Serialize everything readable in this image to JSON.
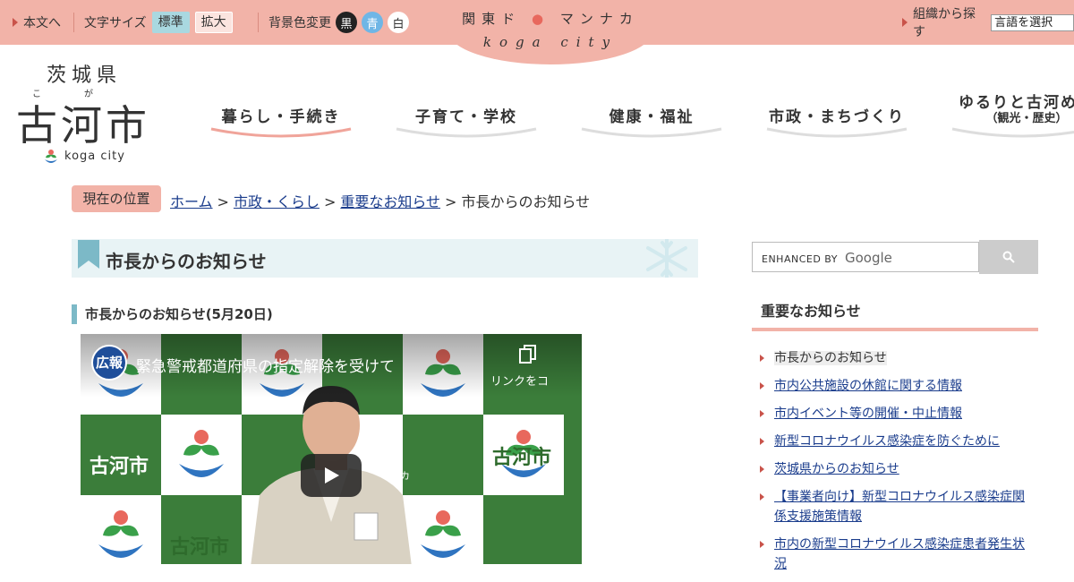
{
  "utility": {
    "skip_label": "本文へ",
    "font_size_label": "文字サイズ",
    "font_size_normal": "標準",
    "font_size_large": "拡大",
    "bg_color_label": "背景色変更",
    "bg_black": "黒",
    "bg_blue": "青",
    "bg_white": "白",
    "org_search_label": "組織から探す",
    "language_select": "言語を選択"
  },
  "center_badge": {
    "top_words": [
      "関東ド",
      "マンナカ"
    ],
    "bottom": "koga city"
  },
  "logo": {
    "prefecture": "茨城県",
    "ruby_1": "こ",
    "ruby_2": "が",
    "city": "古河市",
    "koga_text": "koga city"
  },
  "global_nav": [
    {
      "label": "暮らし・手続き",
      "sub": "",
      "active": true
    },
    {
      "label": "子育て・学校",
      "sub": ""
    },
    {
      "label": "健康・福祉",
      "sub": ""
    },
    {
      "label": "市政・まちづくり",
      "sub": ""
    },
    {
      "label": "ゆるりと古河めぐ",
      "sub": "（観光・歴史）"
    }
  ],
  "breadcrumb": {
    "current_label": "現在の位置",
    "items": [
      "ホーム",
      "市政・くらし",
      "重要なお知らせ"
    ],
    "current": "市長からのお知らせ",
    "separator": ">"
  },
  "main": {
    "title": "市長からのお知らせ",
    "section_title": "市長からのお知らせ(5月20日)"
  },
  "video": {
    "channel": "広報",
    "title": "緊急警戒都道府県の指定解除を受けて",
    "copy_label": "リンクをコ",
    "backdrop_text": "古河市",
    "backdrop_sub": "関東ド・マンナカ"
  },
  "sidebar": {
    "search_brand_prefix": "ENHANCED BY",
    "search_brand": "Google",
    "heading": "重要なお知らせ",
    "links": [
      "市長からのお知らせ",
      "市内公共施設の休館に関する情報",
      "市内イベント等の開催・中止情報",
      "新型コロナウイルス感染症を防ぐために",
      "茨城県からのお知らせ",
      "【事業者向け】新型コロナウイルス感染症関係支援施策情報",
      "市内の新型コロナウイルス感染症患者発生状況"
    ]
  },
  "colors": {
    "header_pink": "#f2b3a8",
    "accent_teal": "#7cb9c7",
    "link_blue": "#1a3c8c",
    "video_green": "#3d7a3a"
  }
}
